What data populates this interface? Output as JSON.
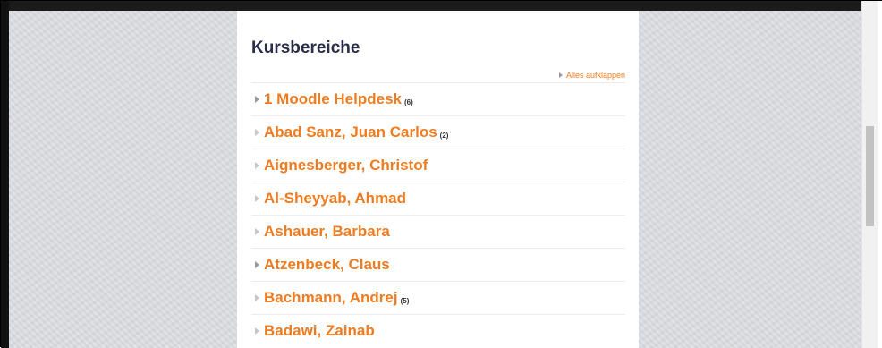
{
  "heading": "Kursbereiche",
  "expand_all": "Alles aufklappen",
  "colors": {
    "link": "#f07c22",
    "heading": "#2b2e4a"
  },
  "categories": [
    {
      "name": "1 Moodle Helpdesk",
      "count": "(6)",
      "caret": "filled"
    },
    {
      "name": "Abad Sanz, Juan Carlos",
      "count": "(2)",
      "caret": "hollow"
    },
    {
      "name": "Aignesberger, Christof",
      "count": "",
      "caret": "hollow"
    },
    {
      "name": "Al-Sheyyab, Ahmad",
      "count": "",
      "caret": "hollow"
    },
    {
      "name": "Ashauer, Barbara",
      "count": "",
      "caret": "hollow"
    },
    {
      "name": "Atzenbeck, Claus",
      "count": "",
      "caret": "filled"
    },
    {
      "name": "Bachmann, Andrej",
      "count": "(5)",
      "caret": "hollow"
    },
    {
      "name": "Badawi, Zainab",
      "count": "",
      "caret": "hollow"
    }
  ]
}
